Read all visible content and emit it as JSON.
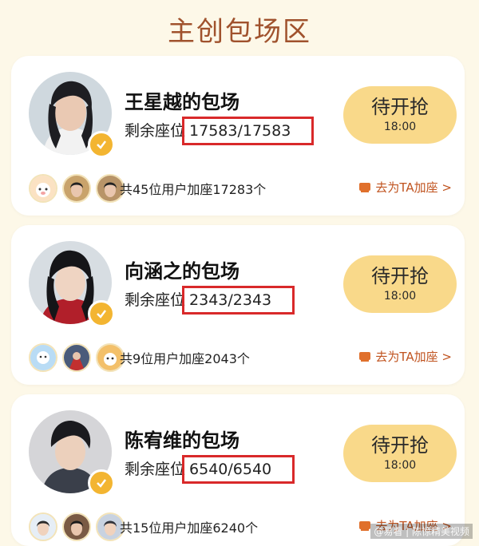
{
  "title": "主创包场区",
  "cards": [
    {
      "name": "王星越的包场",
      "seats_label": "剩余座位",
      "seats_value": "17583/17583",
      "button_label": "待开抢",
      "button_time": "18:00",
      "join_text": "共45位用户加座17283个",
      "join_link": "去为TA加座 >"
    },
    {
      "name": "向涵之的包场",
      "seats_label": "剩余座位",
      "seats_value": "2343/2343",
      "button_label": "待开抢",
      "button_time": "18:00",
      "join_text": "共9位用户加座2043个",
      "join_link": "去为TA加座 >"
    },
    {
      "name": "陈宥维的包场",
      "seats_label": "剩余座位",
      "seats_value": "6540/6540",
      "button_label": "待开抢",
      "button_time": "18:00",
      "join_text": "共15位用户加座6240个",
      "join_link": "去为TA加座 >"
    }
  ],
  "watermark": "@易看 | 陈惊精美视频",
  "icons": {
    "verify": "check-badge-icon",
    "join": "seat-icon"
  },
  "colors": {
    "background": "#fdf8e8",
    "title": "#a0522d",
    "button": "#f9d98a",
    "highlight_box": "#d9292a",
    "link": "#c0531f",
    "badge": "#f3b531"
  }
}
